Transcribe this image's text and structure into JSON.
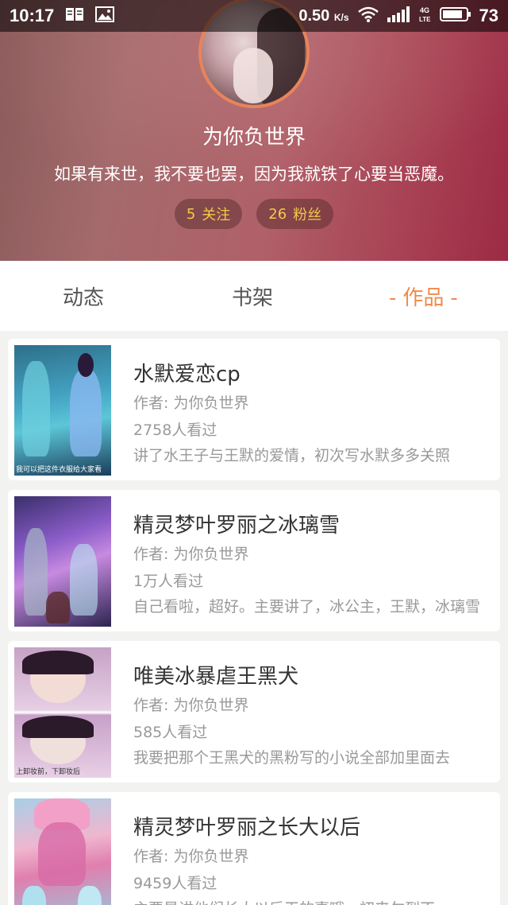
{
  "status_bar": {
    "time": "10:17",
    "speed_value": "0.50",
    "speed_unit": "K/s",
    "network": "4G LTE",
    "battery": "73"
  },
  "profile": {
    "username": "为你负世界",
    "signature": "如果有来世，我不要也罢，因为我就铁了心要当恶魔。",
    "following_count": "5",
    "following_label": "关注",
    "followers_count": "26",
    "followers_label": "粉丝"
  },
  "tabs": [
    {
      "label": "动态",
      "active": false
    },
    {
      "label": "书架",
      "active": false
    },
    {
      "label": "作品",
      "active": true
    }
  ],
  "works": [
    {
      "title": "水默爱恋cp",
      "author": "作者: 为你负世界",
      "views": "2758人看过",
      "description": "讲了水王子与王默的爱情，初次写水默多多关照",
      "cover_caption": "我可以把这件衣服给大家看"
    },
    {
      "title": "精灵梦叶罗丽之冰璃雪",
      "author": "作者: 为你负世界",
      "views": "1万人看过",
      "description": "自己看啦，超好。主要讲了，冰公主，王默，冰璃雪",
      "cover_caption": ""
    },
    {
      "title": "唯美冰暴虐王黑犬",
      "author": "作者: 为你负世界",
      "views": "585人看过",
      "description": "我要把那个王黑犬的黑粉写的小说全部加里面去",
      "cover_caption": "上卸妆前，下卸妆后"
    },
    {
      "title": "精灵梦叶罗丽之长大以后",
      "author": "作者: 为你负世界",
      "views": "9459人看过",
      "description": "主要是讲他们长大以后干的事哦，初来乍到不",
      "cover_caption": ""
    }
  ],
  "colors": {
    "accent": "#f08a4b",
    "stat_text": "#f5c84a"
  }
}
